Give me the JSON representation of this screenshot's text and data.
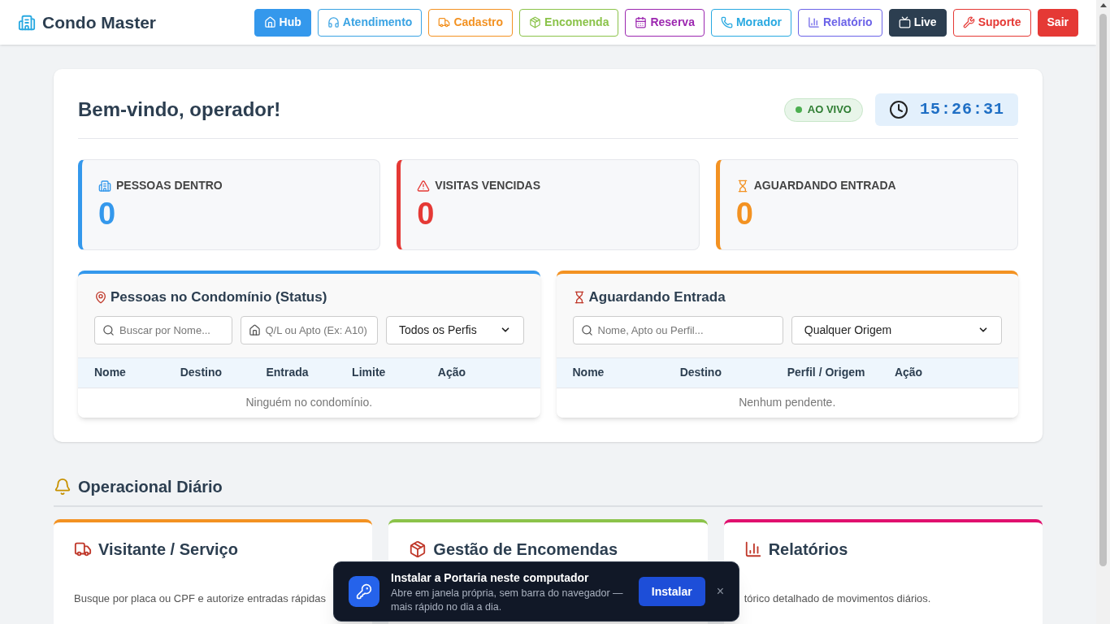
{
  "header": {
    "brand": "Condo Master",
    "nav": [
      {
        "label": "Hub",
        "color": "#3498ec",
        "kind": "solid"
      },
      {
        "label": "Atendimento",
        "color": "#3aa3e3",
        "kind": "outline"
      },
      {
        "label": "Cadastro",
        "color": "#f39222",
        "kind": "outline"
      },
      {
        "label": "Encomenda",
        "color": "#8bc34a",
        "kind": "outline"
      },
      {
        "label": "Reserva",
        "color": "#9c27b0",
        "kind": "outline"
      },
      {
        "label": "Morador",
        "color": "#29a9e1",
        "kind": "outline"
      },
      {
        "label": "Relatório",
        "color": "#6c63e8",
        "kind": "outline"
      },
      {
        "label": "Live",
        "color": "#2c3e50",
        "kind": "solid"
      },
      {
        "label": "Suporte",
        "color": "#e53935",
        "kind": "outline"
      },
      {
        "label": "Sair",
        "color": "#e53935",
        "kind": "solid"
      }
    ]
  },
  "welcome": {
    "title": "Bem-vindo, operador!",
    "live_badge": "AO VIVO",
    "clock": "15:26:31"
  },
  "stats": [
    {
      "label": "PESSOAS DENTRO",
      "value": "0",
      "color": "#3498ec"
    },
    {
      "label": "VISITAS VENCIDAS",
      "value": "0",
      "color": "#e53935"
    },
    {
      "label": "AGUARDANDO ENTRADA",
      "value": "0",
      "color": "#f39222"
    }
  ],
  "panels": [
    {
      "title": "Pessoas no Condomínio (Status)",
      "color": "#3498ec",
      "filters": [
        {
          "kind": "search",
          "placeholder": "Buscar por Nome..."
        },
        {
          "kind": "home",
          "placeholder": "Q/L ou Apto (Ex: A10)"
        },
        {
          "kind": "select",
          "value": "Todos os Perfis"
        }
      ],
      "columns": [
        "Nome",
        "Destino",
        "Entrada",
        "Limite",
        "Ação"
      ],
      "empty": "Ninguém no condomínio."
    },
    {
      "title": "Aguardando Entrada",
      "color": "#f39222",
      "filters": [
        {
          "kind": "search",
          "placeholder": "Nome, Apto ou Perfil..."
        },
        {
          "kind": "select",
          "value": "Qualquer Origem"
        }
      ],
      "columns": [
        "Nome",
        "Destino",
        "Perfil / Origem",
        "Ação"
      ],
      "empty": "Nenhum pendente."
    }
  ],
  "section": {
    "title": "Operacional Diário"
  },
  "cards": [
    {
      "title": "Visitante / Serviço",
      "description": "Busque por placa ou CPF e autorize entradas rápidas",
      "color": "#f39222"
    },
    {
      "title": "Gestão de Encomendas",
      "color": "#8bc34a"
    },
    {
      "title": "Relatórios",
      "description": "tórico detalhado de movimentos diários.",
      "color": "#e0106e"
    }
  ],
  "toast": {
    "title": "Instalar a Portaria neste computador",
    "text": "Abre em janela própria, sem barra do navegador — mais rápido no dia a dia.",
    "button": "Instalar",
    "close": "×"
  }
}
